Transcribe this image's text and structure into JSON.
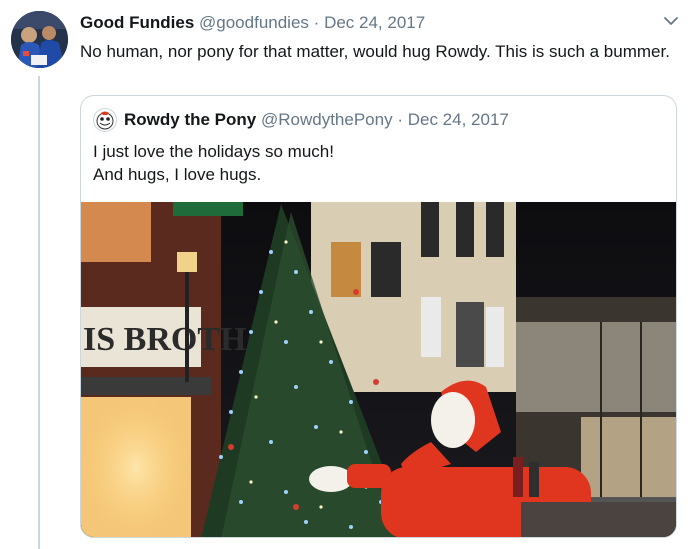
{
  "tweet": {
    "author_name": "Good Fundies",
    "handle": "@goodfundies",
    "separator": "·",
    "date": "Dec 24, 2017",
    "text": "No human, nor pony for that matter, would hug Rowdy. This is such a bummer."
  },
  "quoted_tweet": {
    "author_name": "Rowdy the Pony",
    "handle": "@RowdythePony",
    "separator": "·",
    "date": "Dec 24, 2017",
    "line1": "I just love the holidays so much!",
    "line2": "And hugs, I love hugs.",
    "image_sign_text": "IS BROTH"
  },
  "icons": {
    "menu": "chevron-down-icon"
  },
  "colors": {
    "muted": "#657786",
    "border": "#ccd6dd",
    "mascot_red": "#e0351e"
  }
}
